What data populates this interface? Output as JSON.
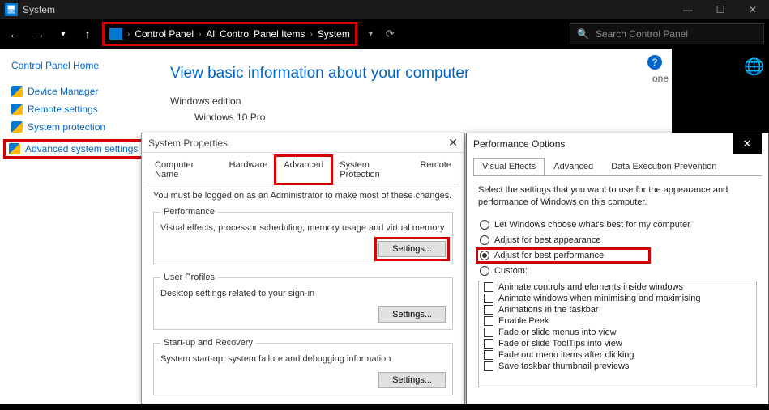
{
  "window": {
    "title": "System"
  },
  "breadcrumb": {
    "a": "Control Panel",
    "b": "All Control Panel Items",
    "c": "System"
  },
  "search": {
    "placeholder": "Search Control Panel"
  },
  "leftnav": {
    "home": "Control Panel Home",
    "links": [
      "Device Manager",
      "Remote settings",
      "System protection",
      "Advanced system settings"
    ]
  },
  "main": {
    "heading": "View basic information about your computer",
    "edition_label": "Windows edition",
    "edition_value": "Windows 10 Pro",
    "one": "one"
  },
  "sysprops": {
    "title": "System Properties",
    "tabs": [
      "Computer Name",
      "Hardware",
      "Advanced",
      "System Protection",
      "Remote"
    ],
    "admin_note": "You must be logged on as an Administrator to make most of these changes.",
    "perf": {
      "legend": "Performance",
      "desc": "Visual effects, processor scheduling, memory usage and virtual memory",
      "btn": "Settings..."
    },
    "prof": {
      "legend": "User Profiles",
      "desc": "Desktop settings related to your sign-in",
      "btn": "Settings..."
    },
    "start": {
      "legend": "Start-up and Recovery",
      "desc": "System start-up, system failure and debugging information",
      "btn": "Settings..."
    }
  },
  "perfopts": {
    "title": "Performance Options",
    "tabs": [
      "Visual Effects",
      "Advanced",
      "Data Execution Prevention"
    ],
    "instr": "Select the settings that you want to use for the appearance and performance of Windows on this computer.",
    "radios": [
      "Let Windows choose what's best for my computer",
      "Adjust for best appearance",
      "Adjust for best performance",
      "Custom:"
    ],
    "checks": [
      "Animate controls and elements inside windows",
      "Animate windows when minimising and maximising",
      "Animations in the taskbar",
      "Enable Peek",
      "Fade or slide menus into view",
      "Fade or slide ToolTips into view",
      "Fade out menu items after clicking",
      "Save taskbar thumbnail previews"
    ]
  }
}
